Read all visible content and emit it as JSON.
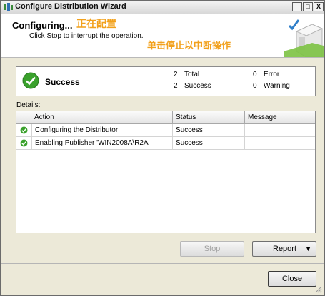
{
  "window": {
    "title": "Configure Distribution Wizard",
    "minimize": "_",
    "maximize": "□",
    "close": "X"
  },
  "header": {
    "title": "Configuring...",
    "subtitle": "Click Stop to interrupt the operation."
  },
  "annotations": {
    "configuring_cn": "正在配置",
    "stop_hint_cn": "单击停止以中断操作"
  },
  "summary": {
    "status": "Success",
    "total_count": "2",
    "total_label": "Total",
    "success_count": "2",
    "success_label": "Success",
    "error_count": "0",
    "error_label": "Error",
    "warning_count": "0",
    "warning_label": "Warning"
  },
  "details": {
    "label": "Details:",
    "columns": [
      "Action",
      "Status",
      "Message"
    ],
    "rows": [
      {
        "action": "Configuring the Distributor",
        "status": "Success",
        "message": "",
        "icon": "success-check-icon"
      },
      {
        "action": "Enabling Publisher 'WIN2008A\\R2A'",
        "status": "Success",
        "message": "",
        "icon": "success-check-icon"
      }
    ]
  },
  "buttons": {
    "stop": "Stop",
    "report": "Report",
    "close": "Close"
  },
  "colors": {
    "annotation": "#f2a11c",
    "success_green": "#3aa12c"
  }
}
